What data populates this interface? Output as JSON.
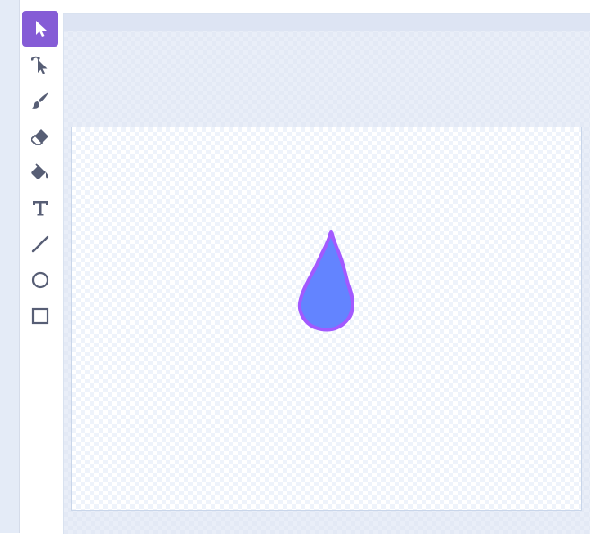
{
  "colors": {
    "accent": "#855cd6",
    "tool_icon": "#575e75",
    "selected_icon": "#ffffff",
    "drop_fill": "#6384ff",
    "drop_outline": "#a259ff"
  },
  "toolbar": {
    "tools": [
      {
        "name": "select-tool",
        "icon": "arrow-pointer-icon",
        "selected": true
      },
      {
        "name": "reshape-tool",
        "icon": "reshape-pointer-icon",
        "selected": false
      },
      {
        "name": "brush-tool",
        "icon": "brush-icon",
        "selected": false
      },
      {
        "name": "eraser-tool",
        "icon": "eraser-icon",
        "selected": false
      },
      {
        "name": "fill-tool",
        "icon": "paint-bucket-icon",
        "selected": false
      },
      {
        "name": "text-tool",
        "icon": "text-icon",
        "selected": false
      },
      {
        "name": "line-tool",
        "icon": "line-icon",
        "selected": false
      },
      {
        "name": "circle-tool",
        "icon": "circle-icon",
        "selected": false
      },
      {
        "name": "rectangle-tool",
        "icon": "rectangle-icon",
        "selected": false
      }
    ]
  },
  "canvas": {
    "shape": "water-drop"
  }
}
